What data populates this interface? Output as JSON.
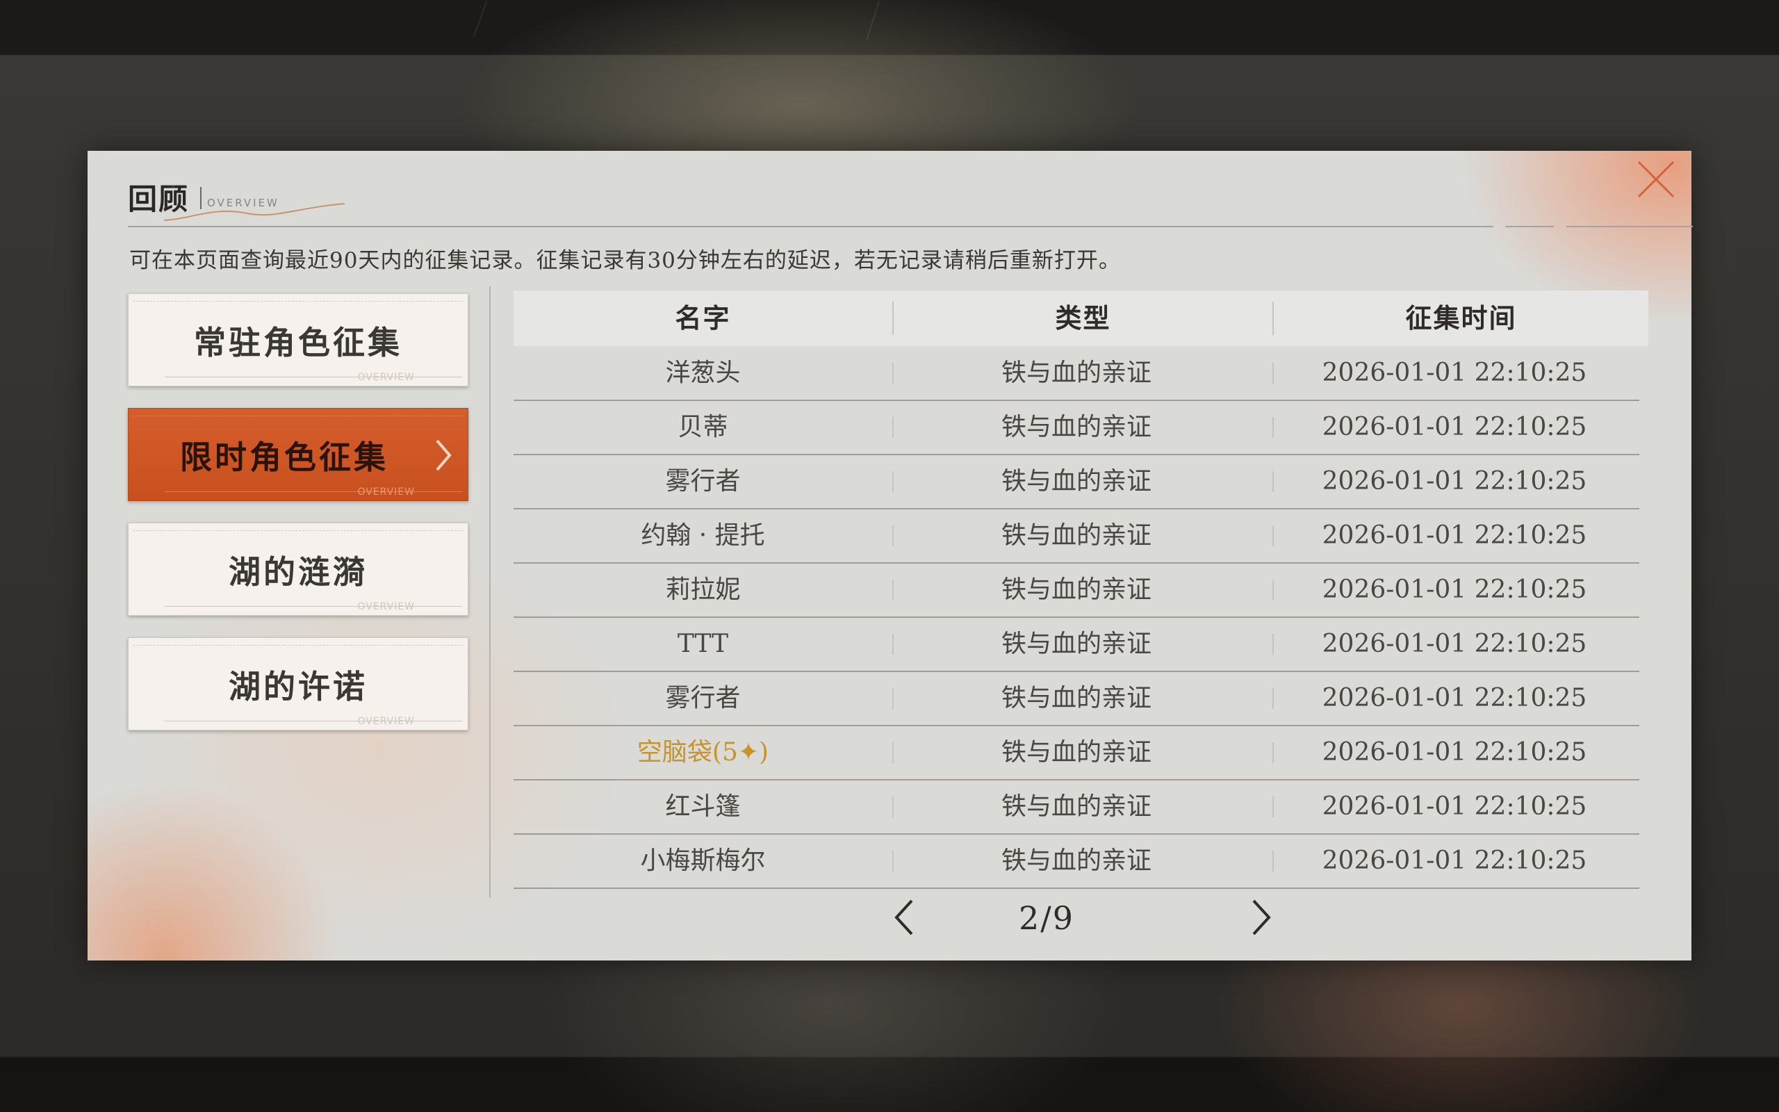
{
  "header": {
    "title": "回顾",
    "subtitle": "OVERVIEW"
  },
  "notice": "可在本页面查询最近90天内的征集记录。征集记录有30分钟左右的延迟，若无记录请稍后重新打开。",
  "tabs": [
    {
      "label": "常驻角色征集",
      "active": false,
      "footer": "OVERVIEW"
    },
    {
      "label": "限时角色征集",
      "active": true,
      "footer": "OVERVIEW"
    },
    {
      "label": "湖的涟漪",
      "active": false,
      "footer": "OVERVIEW"
    },
    {
      "label": "湖的许诺",
      "active": false,
      "footer": "OVERVIEW"
    }
  ],
  "table": {
    "columns": [
      "名字",
      "类型",
      "征集时间"
    ],
    "rows": [
      {
        "name": "洋葱头",
        "type": "铁与血的亲证",
        "time": "2026-01-01 22:10:25"
      },
      {
        "name": "贝蒂",
        "type": "铁与血的亲证",
        "time": "2026-01-01 22:10:25"
      },
      {
        "name": "雾行者",
        "type": "铁与血的亲证",
        "time": "2026-01-01 22:10:25"
      },
      {
        "name": "约翰 · 提托",
        "type": "铁与血的亲证",
        "time": "2026-01-01 22:10:25"
      },
      {
        "name": "莉拉妮",
        "type": "铁与血的亲证",
        "time": "2026-01-01 22:10:25"
      },
      {
        "name": "TTT",
        "type": "铁与血的亲证",
        "time": "2026-01-01 22:10:25"
      },
      {
        "name": "雾行者",
        "type": "铁与血的亲证",
        "time": "2026-01-01 22:10:25"
      },
      {
        "name": "空脑袋(5✦)",
        "type": "铁与血的亲证",
        "time": "2026-01-01 22:10:25",
        "highlight": true
      },
      {
        "name": "红斗篷",
        "type": "铁与血的亲证",
        "time": "2026-01-01 22:10:25"
      },
      {
        "name": "小梅斯梅尔",
        "type": "铁与血的亲证",
        "time": "2026-01-01 22:10:25"
      }
    ]
  },
  "pager": {
    "text": "2/9",
    "current": 2,
    "total": 9
  },
  "icons": {
    "close": "close-icon",
    "prev": "chevron-left-icon",
    "next": "chevron-right-icon",
    "tab_arrow": "chevron-right-icon"
  },
  "colors": {
    "accent": "#d65e2c",
    "highlight": "#c9932b",
    "panel": "#dadad7"
  }
}
